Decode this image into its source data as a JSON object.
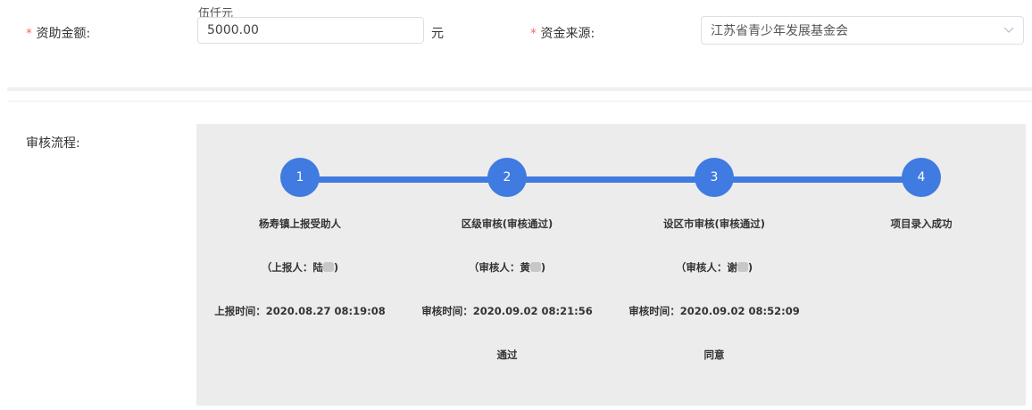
{
  "form": {
    "amount_label": "资助金额:",
    "amount_chinese": "伍仟元",
    "amount_value": "5000.00",
    "amount_unit": "元",
    "source_label": "资金来源:",
    "source_value": "江苏省青少年发展基金会",
    "required_mark": "*"
  },
  "review": {
    "label": "审核流程:",
    "steps": [
      {
        "number": "1",
        "title": "杨寿镇上报受助人",
        "person": "（上报人：陆",
        "time": "上报时间：2020.08.27 08:19:08",
        "remark": ""
      },
      {
        "number": "2",
        "title": "区级审核(审核通过)",
        "person": "（审核人：黄",
        "time": "审核时间：2020.09.02 08:21:56",
        "remark": "通过"
      },
      {
        "number": "3",
        "title": "设区市审核(审核通过)",
        "person": "（审核人：谢",
        "time": "审核时间：2020.09.02 08:52:09",
        "remark": "同意"
      },
      {
        "number": "4",
        "title": "项目录入成功",
        "person": "",
        "time": "",
        "remark": ""
      }
    ],
    "person_suffix": ")"
  },
  "colors": {
    "accent": "#3f7be0",
    "required": "#f56c6c",
    "panel_bg": "#ececec"
  }
}
